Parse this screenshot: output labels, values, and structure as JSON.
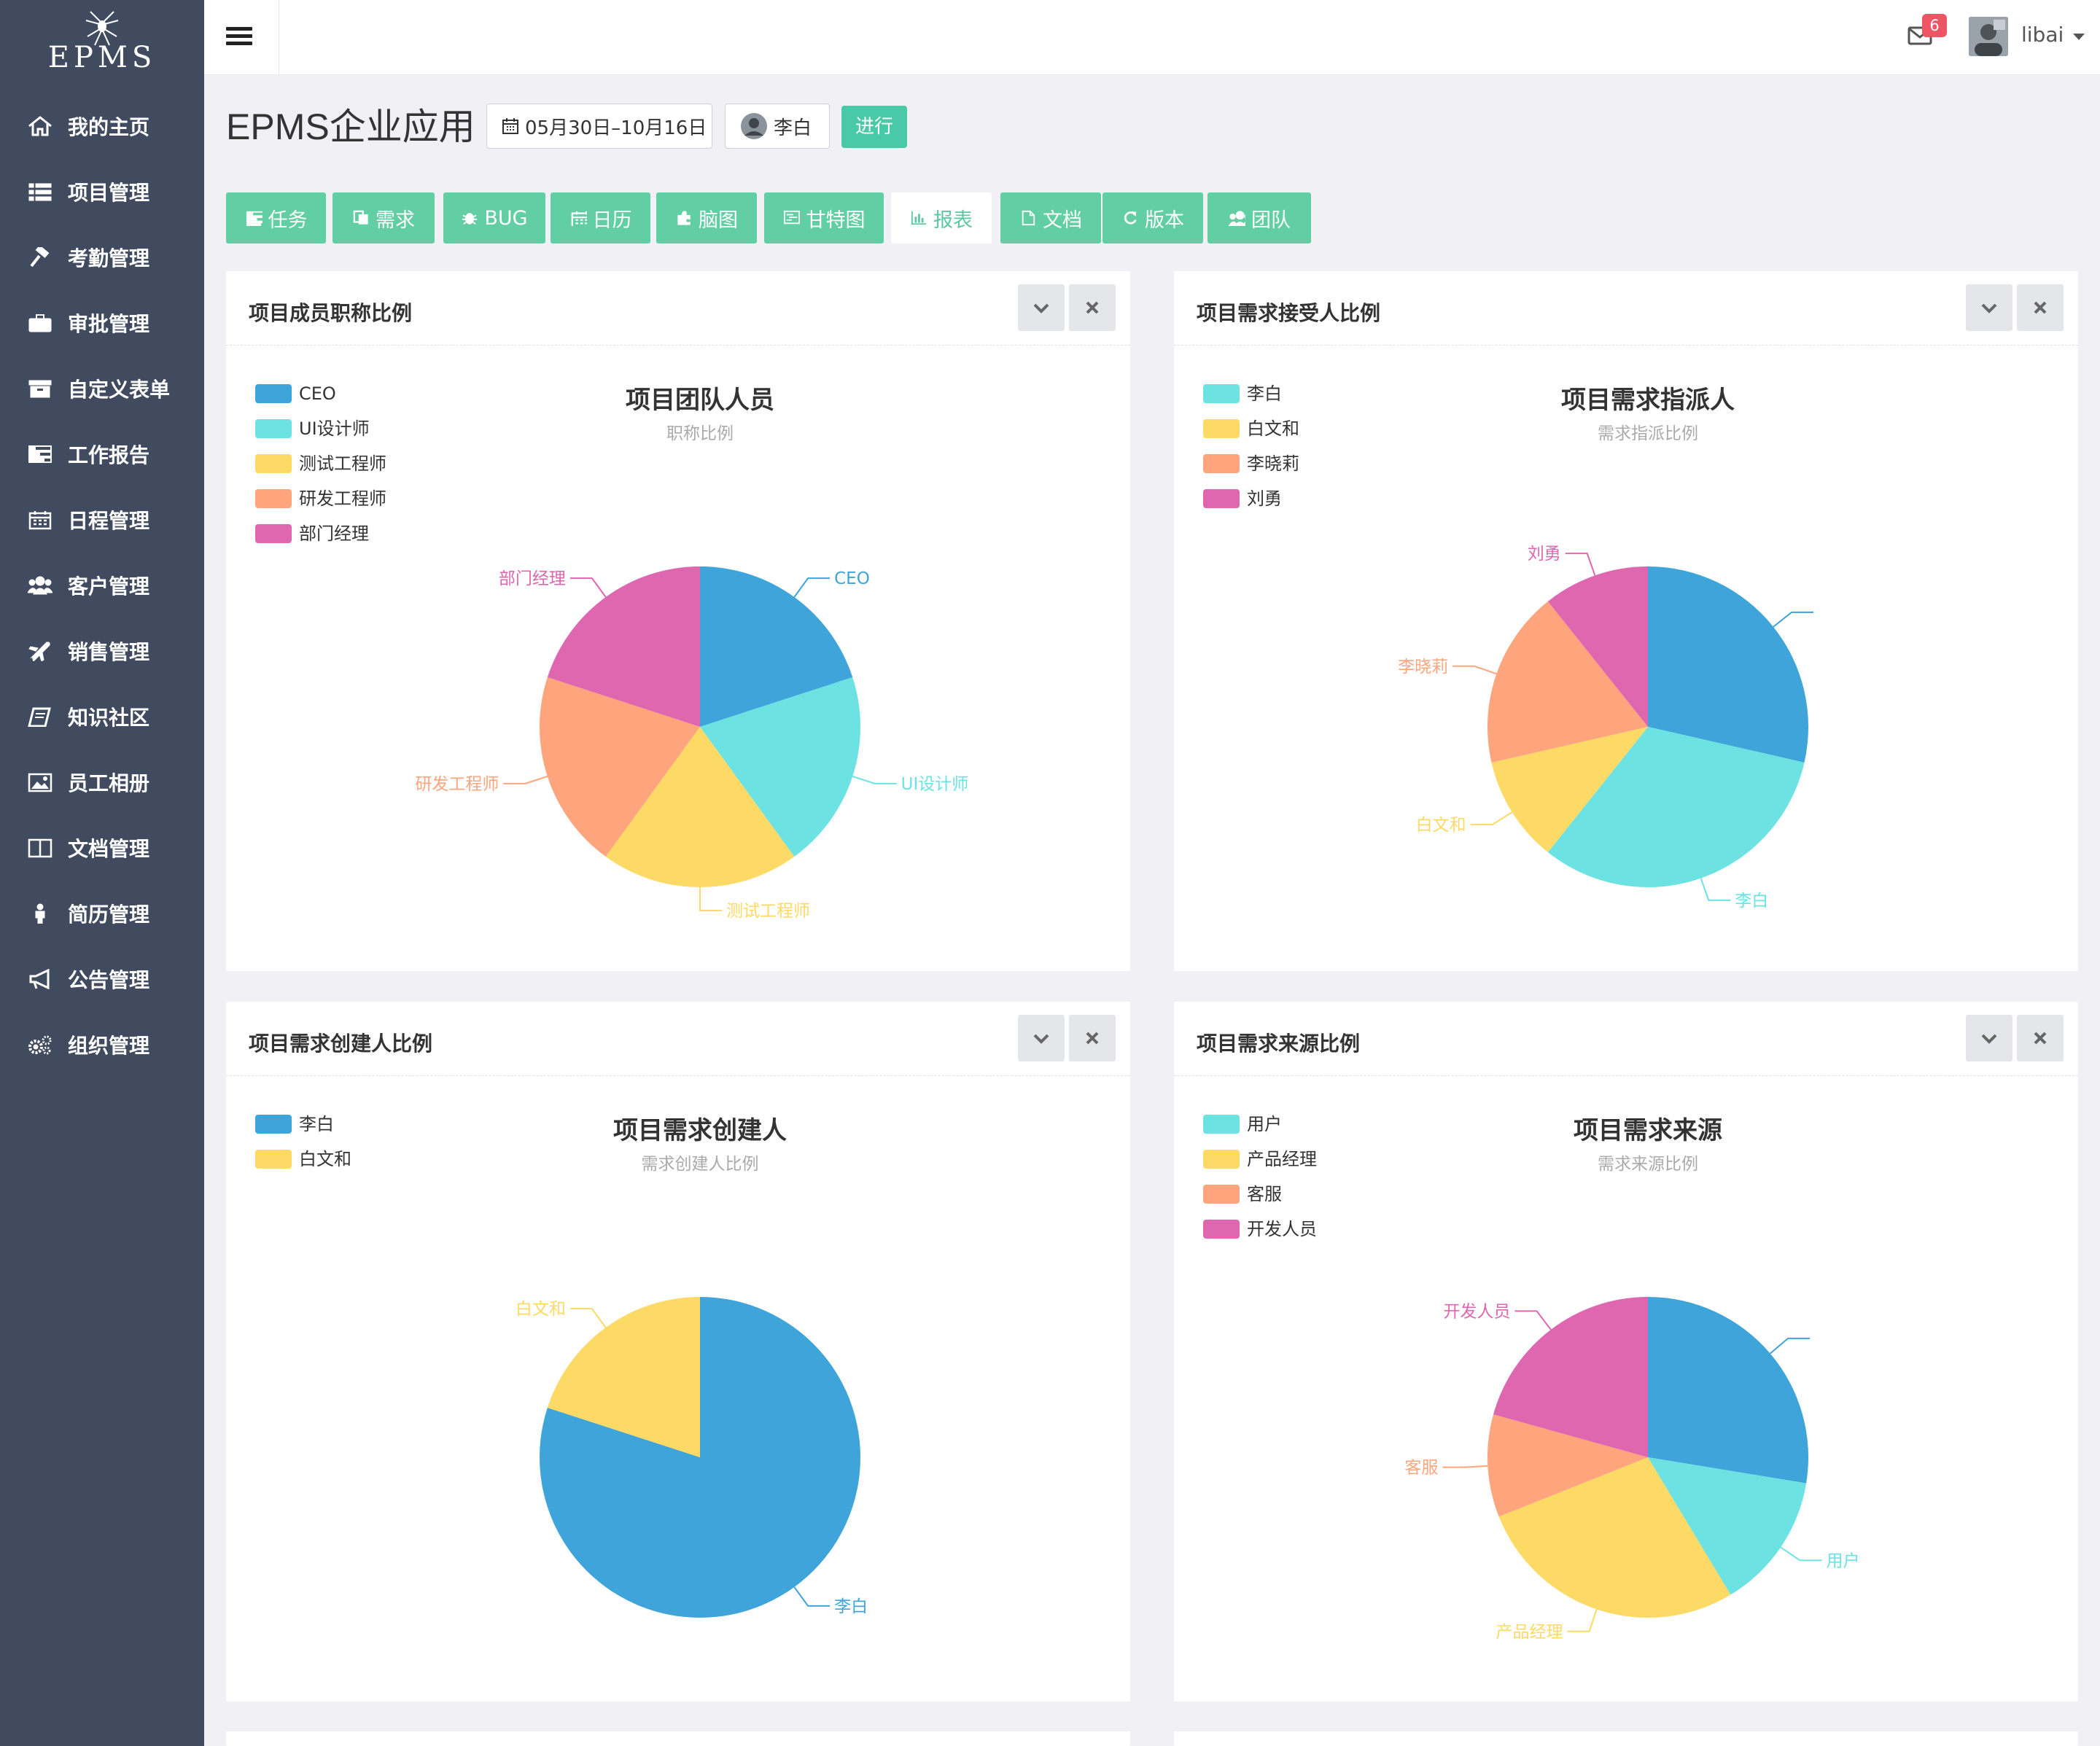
{
  "app": {
    "logo_text": "EPMS"
  },
  "sidebar": {
    "items": [
      {
        "label": "我的主页",
        "icon": "home-icon"
      },
      {
        "label": "项目管理",
        "icon": "list-icon"
      },
      {
        "label": "考勤管理",
        "icon": "gavel-icon"
      },
      {
        "label": "审批管理",
        "icon": "briefcase-icon"
      },
      {
        "label": "自定义表单",
        "icon": "archive-icon"
      },
      {
        "label": "工作报告",
        "icon": "tasks-icon"
      },
      {
        "label": "日程管理",
        "icon": "calendar-icon"
      },
      {
        "label": "客户管理",
        "icon": "users-icon"
      },
      {
        "label": "销售管理",
        "icon": "plane-icon"
      },
      {
        "label": "知识社区",
        "icon": "book-icon"
      },
      {
        "label": "员工相册",
        "icon": "picture-icon"
      },
      {
        "label": "文档管理",
        "icon": "columns-icon"
      },
      {
        "label": "简历管理",
        "icon": "person-icon"
      },
      {
        "label": "公告管理",
        "icon": "bullhorn-icon"
      },
      {
        "label": "组织管理",
        "icon": "cogs-icon"
      }
    ]
  },
  "topbar": {
    "mail_count": "6",
    "username": "libai"
  },
  "project": {
    "title": "EPMS企业应用",
    "date_range": "05月30日–10月16日",
    "owner": "李白",
    "status": "进行"
  },
  "tabs": [
    {
      "label": "任务",
      "icon": "tasks-icon",
      "active": false
    },
    {
      "label": "需求",
      "icon": "copy-icon",
      "active": false
    },
    {
      "label": "BUG",
      "icon": "bug-icon",
      "active": false
    },
    {
      "label": "日历",
      "icon": "calendar-icon",
      "active": false
    },
    {
      "label": "脑图",
      "icon": "puzzle-icon",
      "active": false
    },
    {
      "label": "甘特图",
      "icon": "gantt-icon",
      "active": false
    },
    {
      "label": "报表",
      "icon": "bar-chart-icon",
      "active": true
    },
    {
      "label": "文档",
      "icon": "file-icon",
      "active": false
    },
    {
      "label": "版本",
      "icon": "refresh-icon",
      "active": false
    },
    {
      "label": "团队",
      "icon": "users-icon",
      "active": false
    }
  ],
  "colors": {
    "blue": "#3fa4d9",
    "cyan": "#6de2e3",
    "yellow": "#fdd965",
    "orange": "#fea57e",
    "pink": "#df67b0",
    "teal_button": "#62cea3"
  },
  "panels": [
    {
      "title": "项目成员职称比例"
    },
    {
      "title": "项目需求接受人比例"
    },
    {
      "title": "项目需求创建人比例"
    },
    {
      "title": "项目需求来源比例"
    }
  ],
  "chart_data": [
    {
      "type": "pie",
      "title": "项目团队人员",
      "subtitle": "职称比例",
      "legend_position": "top-left",
      "series": [
        {
          "name": "CEO",
          "value": 1,
          "color": "#3fa4d9"
        },
        {
          "name": "UI设计师",
          "value": 1,
          "color": "#6de2e3"
        },
        {
          "name": "测试工程师",
          "value": 1,
          "color": "#fdd965"
        },
        {
          "name": "研发工程师",
          "value": 1,
          "color": "#fea57e"
        },
        {
          "name": "部门经理",
          "value": 1,
          "color": "#df67b0"
        }
      ]
    },
    {
      "type": "pie",
      "title": "项目需求指派人",
      "subtitle": "需求指派比例",
      "legend_position": "top-left",
      "series": [
        {
          "name": "",
          "value": 8,
          "color": "#3fa4d9"
        },
        {
          "name": "李白",
          "value": 9,
          "color": "#6de2e3"
        },
        {
          "name": "白文和",
          "value": 3,
          "color": "#fdd965"
        },
        {
          "name": "李晓莉",
          "value": 5,
          "color": "#fea57e"
        },
        {
          "name": "刘勇",
          "value": 3,
          "color": "#df67b0"
        }
      ],
      "legend": [
        {
          "name": "李白",
          "color": "#6de2e3"
        },
        {
          "name": "白文和",
          "color": "#fdd965"
        },
        {
          "name": "李晓莉",
          "color": "#fea57e"
        },
        {
          "name": "刘勇",
          "color": "#df67b0"
        }
      ]
    },
    {
      "type": "pie",
      "title": "项目需求创建人",
      "subtitle": "需求创建人比例",
      "legend_position": "top-left",
      "series": [
        {
          "name": "李白",
          "value": 4,
          "color": "#3fa4d9"
        },
        {
          "name": "白文和",
          "value": 1,
          "color": "#fdd965"
        }
      ]
    },
    {
      "type": "pie",
      "title": "项目需求来源",
      "subtitle": "需求来源比例",
      "legend_position": "top-left",
      "series": [
        {
          "name": "",
          "value": 8,
          "color": "#3fa4d9"
        },
        {
          "name": "用户",
          "value": 4,
          "color": "#6de2e3"
        },
        {
          "name": "产品经理",
          "value": 8,
          "color": "#fdd965"
        },
        {
          "name": "客服",
          "value": 3,
          "color": "#fea57e"
        },
        {
          "name": "开发人员",
          "value": 6,
          "color": "#df67b0"
        }
      ],
      "legend": [
        {
          "name": "用户",
          "color": "#6de2e3"
        },
        {
          "name": "产品经理",
          "color": "#fdd965"
        },
        {
          "name": "客服",
          "color": "#fea57e"
        },
        {
          "name": "开发人员",
          "color": "#df67b0"
        }
      ]
    }
  ]
}
